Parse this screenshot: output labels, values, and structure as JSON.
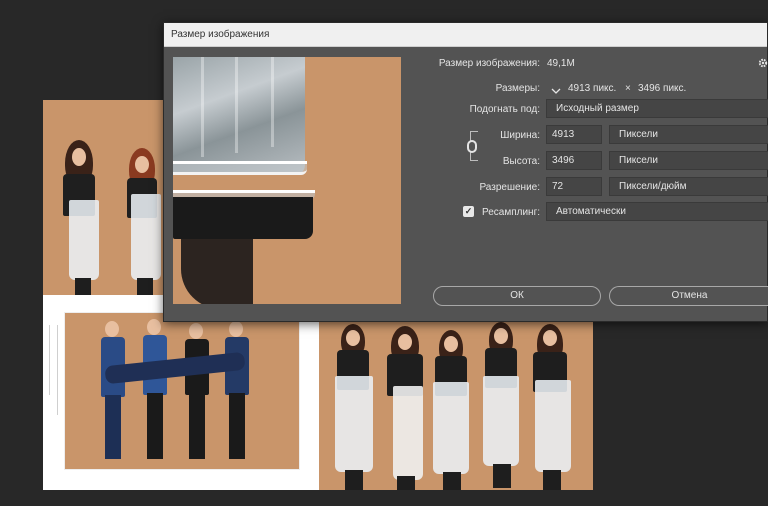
{
  "dialog": {
    "title": "Размер изображения",
    "image_size_label": "Размер изображения:",
    "image_size_value": "49,1M",
    "dimensions_label": "Размеры:",
    "dimensions_width": "4913 пикс.",
    "dimensions_times": "×",
    "dimensions_height": "3496 пикс.",
    "fit_to_label": "Подогнать под:",
    "fit_to_value": "Исходный размер",
    "width_label": "Ширина:",
    "width_value": "4913",
    "width_unit": "Пиксели",
    "height_label": "Высота:",
    "height_value": "3496",
    "height_unit": "Пиксели",
    "resolution_label": "Разрешение:",
    "resolution_value": "72",
    "resolution_unit": "Пиксели/дюйм",
    "resample_label": "Ресамплинг:",
    "resample_checked": true,
    "resample_value": "Автоматически",
    "ok_label": "ОК",
    "cancel_label": "Отмена"
  },
  "icons": {
    "settings": "gear-icon",
    "link": "link-chain-icon",
    "dimensions_dropdown": "chevron-down-icon",
    "checkbox": "checkmark-icon"
  },
  "colors": {
    "dialog_bg": "#535353",
    "titlebar_bg": "#f0f0f0",
    "workspace_bg": "#282828",
    "photo_bg": "#c9956a"
  }
}
